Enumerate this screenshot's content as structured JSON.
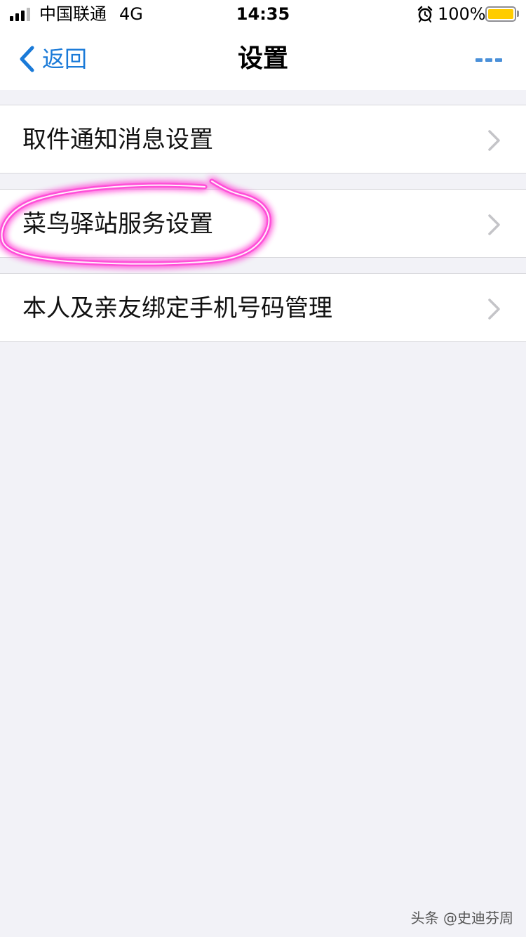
{
  "status_bar": {
    "carrier": "中国联通",
    "network": "4G",
    "time": "14:35",
    "battery_percent": "100%",
    "alarm_icon": "alarm-clock-icon",
    "battery_color": "#ffcc00"
  },
  "nav": {
    "back_label": "返回",
    "title": "设置",
    "more_icon": "more-dots-icon",
    "accent_color": "#1a7ad8"
  },
  "settings": {
    "items": [
      {
        "label": "取件通知消息设置"
      },
      {
        "label": "菜鸟驿站服务设置"
      },
      {
        "label": "本人及亲友绑定手机号码管理"
      }
    ]
  },
  "annotation": {
    "highlight_color": "#ff4fd8"
  },
  "watermark": {
    "text": "头条 @史迪芬周"
  }
}
